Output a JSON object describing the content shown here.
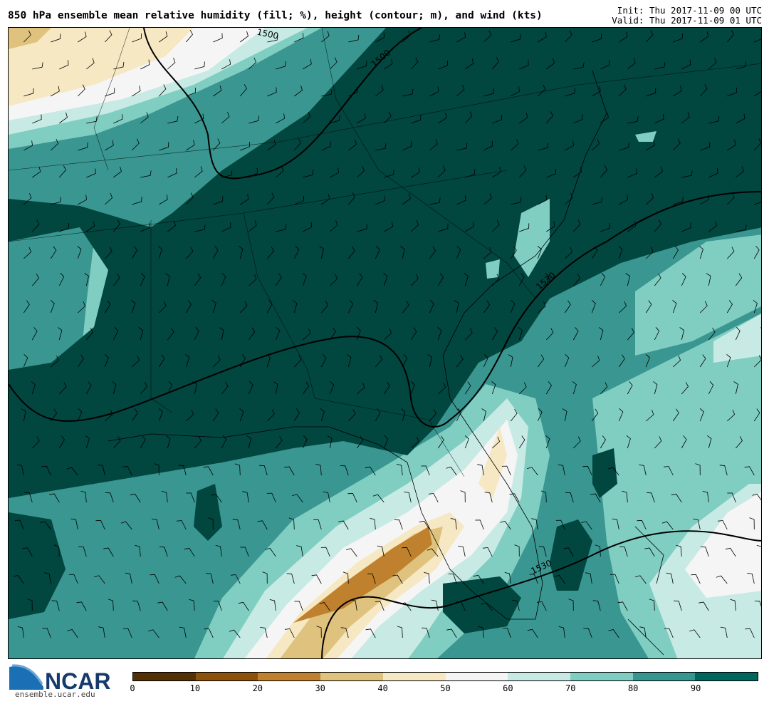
{
  "header": {
    "title": "850 hPa ensemble mean relative humidity (fill; %), height (contour; m), and wind (kts)",
    "init": "Init: Thu 2017-11-09 00 UTC",
    "valid": "Valid: Thu 2017-11-09 01 UTC"
  },
  "map": {
    "variable": "relative humidity",
    "contour_labels": [
      "1500",
      "1500",
      "1530",
      "1530"
    ],
    "barb_color": "#000000"
  },
  "colorbar": {
    "ticks": [
      "0",
      "10",
      "20",
      "30",
      "40",
      "50",
      "60",
      "70",
      "80",
      "90"
    ],
    "colors": [
      "#543005",
      "#8c510a",
      "#bf812d",
      "#dfc27d",
      "#f6e8c3",
      "#f5f5f5",
      "#c7eae5",
      "#80cdc1",
      "#35978f",
      "#01665e"
    ]
  },
  "logo": {
    "name": "NCAR",
    "url": "ensemble.ucar.edu"
  }
}
